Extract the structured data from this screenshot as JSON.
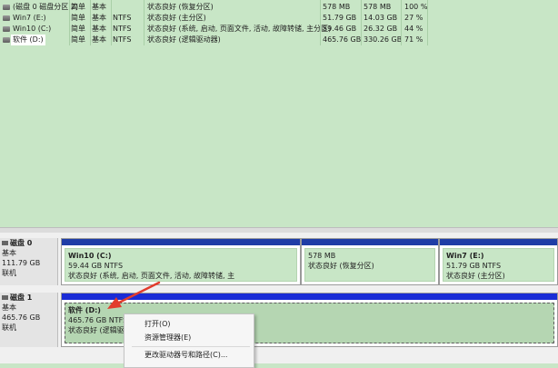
{
  "volumes": [
    {
      "name": "(磁盘 0 磁盘分区 2)",
      "layout": "简单",
      "type": "基本",
      "fs": "",
      "status": "状态良好 (恢复分区)",
      "capacity": "578 MB",
      "free": "578 MB",
      "pct": "100 %"
    },
    {
      "name": "Win7 (E:)",
      "layout": "简单",
      "type": "基本",
      "fs": "NTFS",
      "status": "状态良好 (主分区)",
      "capacity": "51.79 GB",
      "free": "14.03 GB",
      "pct": "27 %"
    },
    {
      "name": "Win10 (C:)",
      "layout": "简单",
      "type": "基本",
      "fs": "NTFS",
      "status": "状态良好 (系统, 启动, 页面文件, 活动, 故障转储, 主分区)",
      "capacity": "59.46 GB",
      "free": "26.32 GB",
      "pct": "44 %"
    },
    {
      "name": "软件 (D:)",
      "layout": "简单",
      "type": "基本",
      "fs": "NTFS",
      "status": "状态良好 (逻辑驱动器)",
      "capacity": "465.76 GB",
      "free": "330.26 GB",
      "pct": "71 %"
    }
  ],
  "disks": [
    {
      "name": "磁盘 0",
      "type": "基本",
      "size": "111.79 GB",
      "state": "联机",
      "partitions": [
        {
          "title": "Win10 (C:)",
          "size": "59.44 GB NTFS",
          "status": "状态良好 (系统, 启动, 页面文件, 活动, 故障转储, 主"
        },
        {
          "title": "",
          "size": "578 MB",
          "status": "状态良好 (恢复分区)"
        },
        {
          "title": "Win7 (E:)",
          "size": "51.79 GB NTFS",
          "status": "状态良好 (主分区)"
        }
      ]
    },
    {
      "name": "磁盘 1",
      "type": "基本",
      "size": "465.76 GB",
      "state": "联机",
      "partitions": [
        {
          "title": "软件 (D:)",
          "size": "465.76 GB NTFS",
          "status": "状态良好 (逻辑驱动"
        }
      ]
    }
  ],
  "context_menu": {
    "items": [
      "打开(O)",
      "资源管理器(E)",
      "更改驱动器号和路径(C)..."
    ]
  },
  "colors": {
    "annotation_arrow": "#e23c2c",
    "primary_bar": "#1f3da6",
    "logical_bar": "#1a2cd6",
    "volume_bg": "#c8e6c6"
  }
}
